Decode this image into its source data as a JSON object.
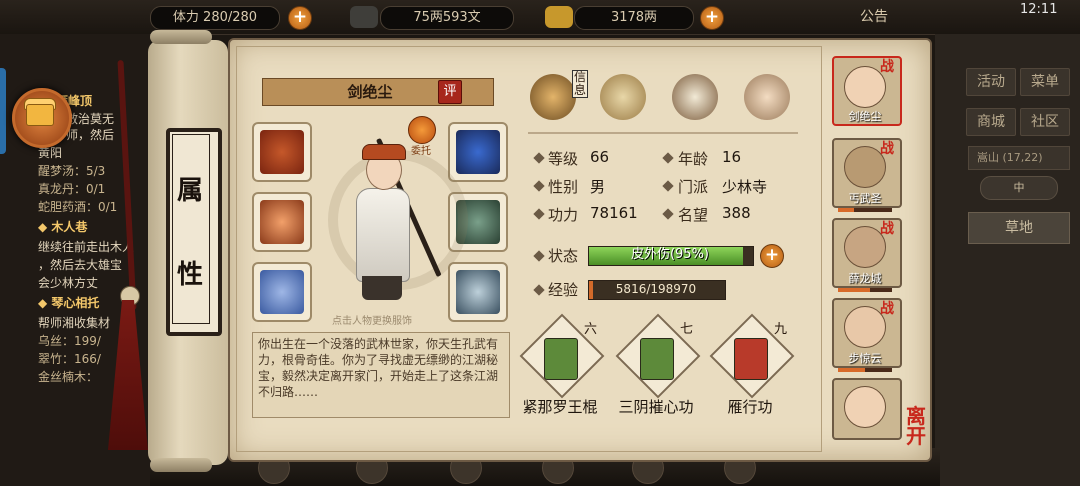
{
  "topbar": {
    "stamina": "体力 280/280",
    "silver": "75两593文",
    "gold": "3178两",
    "notice": "公告",
    "time": "12:11"
  },
  "quests": {
    "q1_title": "雁峰顶",
    "q1_lines": [
      "救治莫无",
      "师，然后",
      "黄阳"
    ],
    "q1_items": [
      "醒梦汤：5/3",
      "真龙丹：0/1",
      "蛇胆药酒：0/1"
    ],
    "q2_title": "木人巷",
    "q2_lines": [
      "继续往前走出木人",
      "，然后去大雄宝",
      "会少林方丈"
    ],
    "q3_title": "琴心相托",
    "q3_lines": [
      "帮师湘收集材",
      "乌丝：199/",
      "翠竹：166/",
      "金丝楠木："
    ]
  },
  "right_menu": {
    "activity": "活动",
    "bag": "菜单",
    "shop": "商城",
    "community": "社区",
    "location": "嵩山 (17,22)",
    "knob": "中",
    "terrain": "草地"
  },
  "scroll": {
    "title_chars": [
      "属",
      "性"
    ]
  },
  "character": {
    "name": "剑绝尘",
    "rate": "评",
    "entrust": "委托",
    "hint": "点击人物更换服饰",
    "bio": "你出生在一个没落的武林世家，你天生孔武有力，根骨奇佳。你为了寻找虚无缥缈的江湖秘宝，毅然决定离开家门，开始走上了这条江湖不归路……"
  },
  "tabs": {
    "info_label": "信息"
  },
  "stats": [
    {
      "label": "等级",
      "value": "66"
    },
    {
      "label": "年龄",
      "value": "16"
    },
    {
      "label": "性别",
      "value": "男"
    },
    {
      "label": "门派",
      "value": "少林寺"
    },
    {
      "label": "功力",
      "value": "78161"
    },
    {
      "label": "名望",
      "value": "388"
    }
  ],
  "status": {
    "label": "状态",
    "text": "皮外伤(95%)",
    "fill": 0.95
  },
  "exp": {
    "label": "经验",
    "text": "5816/198970",
    "fill": 0.029
  },
  "skills": [
    {
      "rank": "六",
      "name": "紧那罗王棍",
      "color": "#5d8a3a"
    },
    {
      "rank": "七",
      "name": "三阴摧心功",
      "color": "#5d8a3a"
    },
    {
      "rank": "九",
      "name": "雁行功",
      "color": "#b83a2a"
    }
  ],
  "roster": [
    {
      "name": "剑绝尘",
      "fight": "战",
      "hp": 0.9
    },
    {
      "name": "丐武圣",
      "fight": "战",
      "hp": 0.3
    },
    {
      "name": "薛龙城",
      "fight": "战",
      "hp": 0.6
    },
    {
      "name": "步惊云",
      "fight": "战",
      "hp": 0.5
    },
    {
      "name": "",
      "fight": "",
      "hp": 0
    }
  ],
  "leave": "离开",
  "colors": {
    "accent": "#a7271c",
    "parchment": "#e9dcc0",
    "status_green": "#6cb440",
    "exp_orange": "#d26a2a"
  }
}
